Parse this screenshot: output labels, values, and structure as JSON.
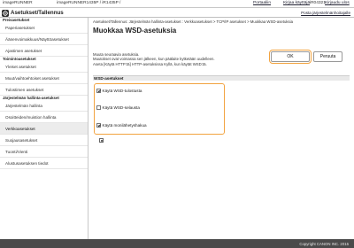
{
  "topbar": {
    "brand_left": "imageRUNNER",
    "brand_model": "imageRUNNER1435P / iR1435P /",
    "portal_link": "Portaaliin",
    "logout_link": "Kirjaa käyttäjä",
    "user_info": "iR04321",
    "logout_short": "Kirjaudu ulos"
  },
  "header": {
    "title": "Asetukset/Tallennus",
    "portal_link": "Posta järjestelmänhoitajalle",
    "icon": "settings-gear-icon"
  },
  "sidebar": {
    "section_prefs": "Preisasetukset",
    "items_prefs": [
      "Paperiasetukset",
      "Äänenvoimakkuus/Näyttöasetukset",
      "Ajastimen asetukset"
    ],
    "section_common": "Toimintoasetukset",
    "items_common": [
      "Yleiset asetukset",
      "Muut/vaihtoehtoiset asetukset",
      "Tulostimen asetukset"
    ],
    "section_mgmt": "Järjestelmän hallinta-asetukset",
    "items_mgmt": [
      "Järjestelmän hallinta",
      "Osoitteiden/muistion hallinta",
      "Verkkoasetukset",
      "Suojausasetukset",
      "Tuonti/Vienti",
      "Alustusasetuksen tiedot"
    ],
    "selected": "Verkkoasetukset"
  },
  "main": {
    "breadcrumb": "Asetukset/Tallennus: Järjestelmän hallinta-asetukset : Verkkoasetukset > TCP/IP asetukset > Muokkaa WSD-asetuksia",
    "page_title": "Muokkaa WSD-asetuksia",
    "info_lines": [
      "Muuta seuraavia asetuksia.",
      "Muutokset ovat voimassa sen jälkeen, kun päälaite kytketään uudelleen.",
      "Aseta [Käytä HTTP:tä] HTTP-asetuksissa Kyllä, kun käytät WSD:tä."
    ],
    "ok_button": "OK",
    "cancel_button": "Peruuta",
    "section_label": "WSD-asetukset",
    "options": [
      {
        "label": "Käytä WSD-tulostusta",
        "checked": true
      },
      {
        "label": "Käytä WSD-selausta",
        "checked": false
      },
      {
        "label": "Käytä monilähetyshakua",
        "checked": true
      }
    ],
    "highlight_color": "#f2a340"
  },
  "footer": {
    "copyright": "Copyright CANON INC. 2015"
  }
}
